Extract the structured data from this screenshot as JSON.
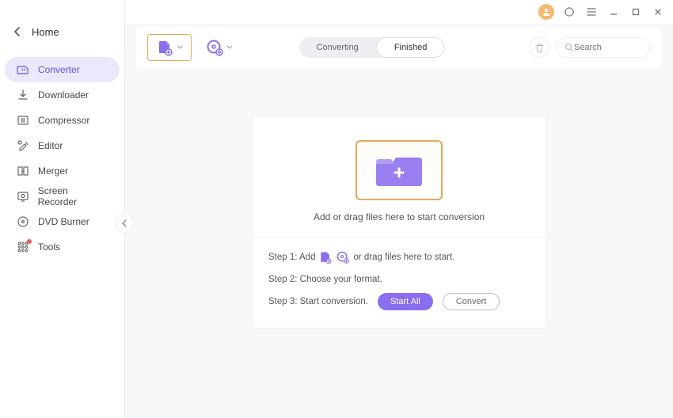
{
  "sidebar": {
    "home": "Home",
    "items": [
      {
        "label": "Converter"
      },
      {
        "label": "Downloader"
      },
      {
        "label": "Compressor"
      },
      {
        "label": "Editor"
      },
      {
        "label": "Merger"
      },
      {
        "label": "Screen Recorder"
      },
      {
        "label": "DVD Burner"
      },
      {
        "label": "Tools"
      }
    ]
  },
  "toolbar": {
    "search_placeholder": "Search"
  },
  "tabs": {
    "converting": "Converting",
    "finished": "Finished"
  },
  "drop": {
    "headline": "Add or drag files here to start conversion",
    "step1_prefix": "Step 1: Add",
    "step1_suffix": "or drag files here to start.",
    "step2": "Step 2: Choose your format.",
    "step3": "Step 3: Start conversion.",
    "start_all": "Start All",
    "convert": "Convert"
  }
}
